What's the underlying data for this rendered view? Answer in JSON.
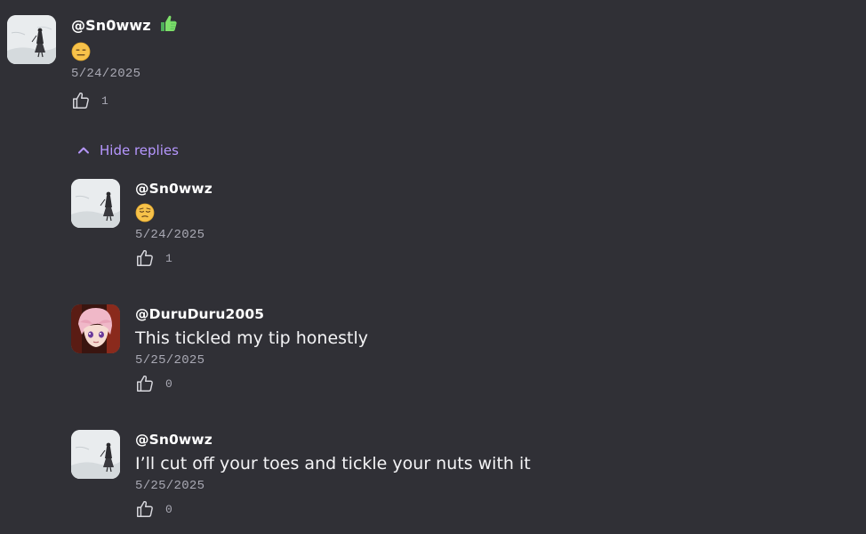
{
  "comments": [
    {
      "username": "@Sn0wwz",
      "badge_icon": "thumbs-up-badge-icon",
      "content_emoji": "expressionless-face-emoji",
      "date": "5/24/2025",
      "likes": "1"
    }
  ],
  "replies_toggle": {
    "label": "Hide replies",
    "icon": "chevron-up-icon"
  },
  "replies": [
    {
      "username": "@Sn0wwz",
      "content_emoji": "pensive-face-emoji",
      "date": "5/24/2025",
      "likes": "1"
    },
    {
      "username": "@DuruDuru2005",
      "text": "This tickled my tip honestly",
      "date": "5/25/2025",
      "likes": "0"
    },
    {
      "username": "@Sn0wwz",
      "text": "I’ll cut off your toes and tickle your nuts with it",
      "date": "5/25/2025",
      "likes": "0"
    }
  ],
  "colors": {
    "background": "#303036",
    "accent": "#b697ff",
    "muted": "#a9a9b4",
    "badge_green": "#7ee06a"
  }
}
